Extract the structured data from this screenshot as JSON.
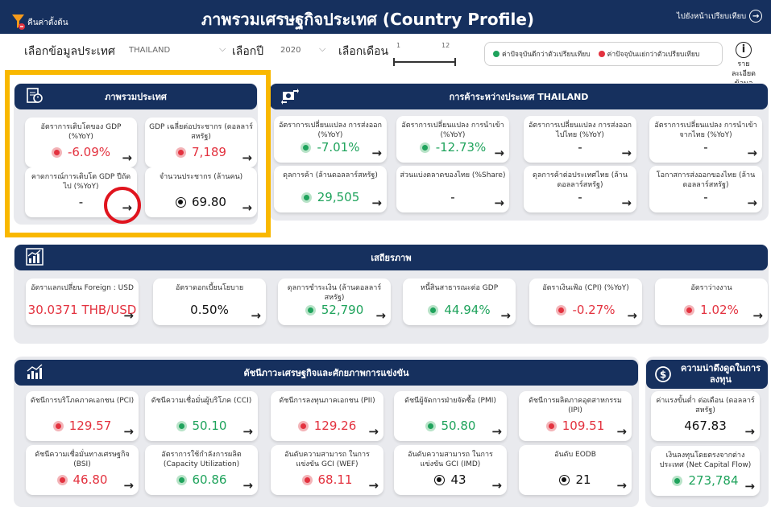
{
  "header": {
    "reset_label": "คืนค่าตั้งต้น",
    "title": "ภาพรวมเศรษฐกิจประเทศ (Country Profile)",
    "compare_link": "ไปยังหน้าเปรียบเทียบ"
  },
  "filters": {
    "country_label": "เลือกข้อมูลประเทศ",
    "country_value": "THAILAND",
    "year_label": "เลือกปี",
    "year_value": "2020",
    "month_label": "เลือกเดือน",
    "month_min": "1",
    "month_max": "12"
  },
  "legend": {
    "good": "ค่าปัจจุบันดีกว่าตัวเปรียบเทียบ",
    "bad": "ค่าปัจจุบันแย่กว่าตัวเปรียบเทียบ"
  },
  "info_button": {
    "line1": "รายละเอียด",
    "line2": "ข้อมูล"
  },
  "colors": {
    "navy": "#16305e",
    "good": "#1fa35c",
    "bad": "#e3323f",
    "highlight": "#f9b800"
  },
  "overview": {
    "title": "ภาพรวมประเทศ",
    "cards": [
      {
        "title": "อัตราการเติบโตของ GDP (%YoY)",
        "value": "-6.09%",
        "status": "red"
      },
      {
        "title": "GDP เฉลี่ยต่อประชากร (ดอลลาร์สหรัฐ)",
        "value": "7,189",
        "status": "red"
      },
      {
        "title": "คาดการณ์การเติบโต GDP ปีถัดไป (%YoY)",
        "value": "-",
        "status": "none"
      },
      {
        "title": "จำนวนประชากร (ล้านคน)",
        "value": "69.80",
        "status": "black"
      }
    ]
  },
  "trade": {
    "title": "การค้าระหว่างประเทศ THAILAND",
    "cards": [
      {
        "title": "อัตราการเปลี่ยนแปลง การส่งออก (%YoY)",
        "value": "-7.01%",
        "status": "green"
      },
      {
        "title": "อัตราการเปลี่ยนแปลง การนำเข้า (%YoY)",
        "value": "-12.73%",
        "status": "green"
      },
      {
        "title": "อัตราการเปลี่ยนแปลง การส่งออกไปไทย (%YoY)",
        "value": "-",
        "status": "none"
      },
      {
        "title": "อัตราการเปลี่ยนแปลง การนำเข้าจากไทย (%YoY)",
        "value": "-",
        "status": "none"
      },
      {
        "title": "ดุลการค้า (ล้านดอลลาร์สหรัฐ)",
        "value": "29,505",
        "status": "green"
      },
      {
        "title": "ส่วนแบ่งตลาดของไทย (%Share)",
        "value": "-",
        "status": "none"
      },
      {
        "title": "ดุลการค้าต่อประเทศไทย (ล้านดอลลาร์สหรัฐ)",
        "value": "-",
        "status": "none"
      },
      {
        "title": "โอกาสการส่งออกของไทย (ล้านดอลลาร์สหรัฐ)",
        "value": "-",
        "status": "none"
      }
    ]
  },
  "stability": {
    "title": "เสถียรภาพ",
    "cards": [
      {
        "title": "อัตราแลกเปลี่ยน Foreign : USD",
        "value": "30.0371 THB/USD",
        "status": "red_text"
      },
      {
        "title": "อัตราดอกเบี้ยนโยบาย",
        "value": "0.50%",
        "status": "none_black"
      },
      {
        "title": "ดุลการชำระเงิน (ล้านดอลลาร์สหรัฐ)",
        "value": "52,790",
        "status": "green"
      },
      {
        "title": "หนี้สินสาธารณะต่อ GDP",
        "value": "44.94%",
        "status": "green"
      },
      {
        "title": "อัตราเงินเฟ้อ (CPI) (%YoY)",
        "value": "-0.27%",
        "status": "red"
      },
      {
        "title": "อัตราว่างงาน",
        "value": "1.02%",
        "status": "red"
      }
    ]
  },
  "competitiveness": {
    "title": "ดัชนีภาวะเศรษฐกิจและศักยภาพการแข่งขัน",
    "cards": [
      {
        "title": "ดัชนีการบริโภคภาคเอกชน (PCI)",
        "value": "129.57",
        "status": "red"
      },
      {
        "title": "ดัชนีความเชื่อมั่นผู้บริโภค (CCI)",
        "value": "50.10",
        "status": "green"
      },
      {
        "title": "ดัชนีการลงทุนภาคเอกชน (PII)",
        "value": "129.26",
        "status": "red"
      },
      {
        "title": "ดัชนีผู้จัดการฝ่ายจัดซื้อ (PMI)",
        "value": "50.80",
        "status": "green"
      },
      {
        "title": "ดัชนีการผลิตภาคอุตสาหกรรม (IPI)",
        "value": "109.51",
        "status": "red"
      },
      {
        "title": "ดัชนีความเชื่อมั่นทางเศรษฐกิจ (BSI)",
        "value": "46.80",
        "status": "red"
      },
      {
        "title": "อัตราการใช้กำลังการผลิต (Capacity Utilization)",
        "value": "60.86",
        "status": "green"
      },
      {
        "title": "อันดับความสามารถ ในการแข่งขัน GCI (WEF)",
        "value": "68.11",
        "status": "red"
      },
      {
        "title": "อันดับความสามารถ ในการแข่งขัน GCI (IMD)",
        "value": "43",
        "status": "black"
      },
      {
        "title": "อันดับ EODB",
        "value": "21",
        "status": "black"
      }
    ]
  },
  "investment": {
    "title": "ความน่าดึงดูดในการลงทุน",
    "cards": [
      {
        "title": "ค่าแรงขั้นต่ำ ต่อเดือน (ดอลลาร์สหรัฐ)",
        "value": "467.83",
        "status": "none_black"
      },
      {
        "title": "เงินลงทุนโดยตรงจากต่างประเทศ (Net Capital Flow)",
        "value": "273,784",
        "status": "green"
      }
    ]
  }
}
